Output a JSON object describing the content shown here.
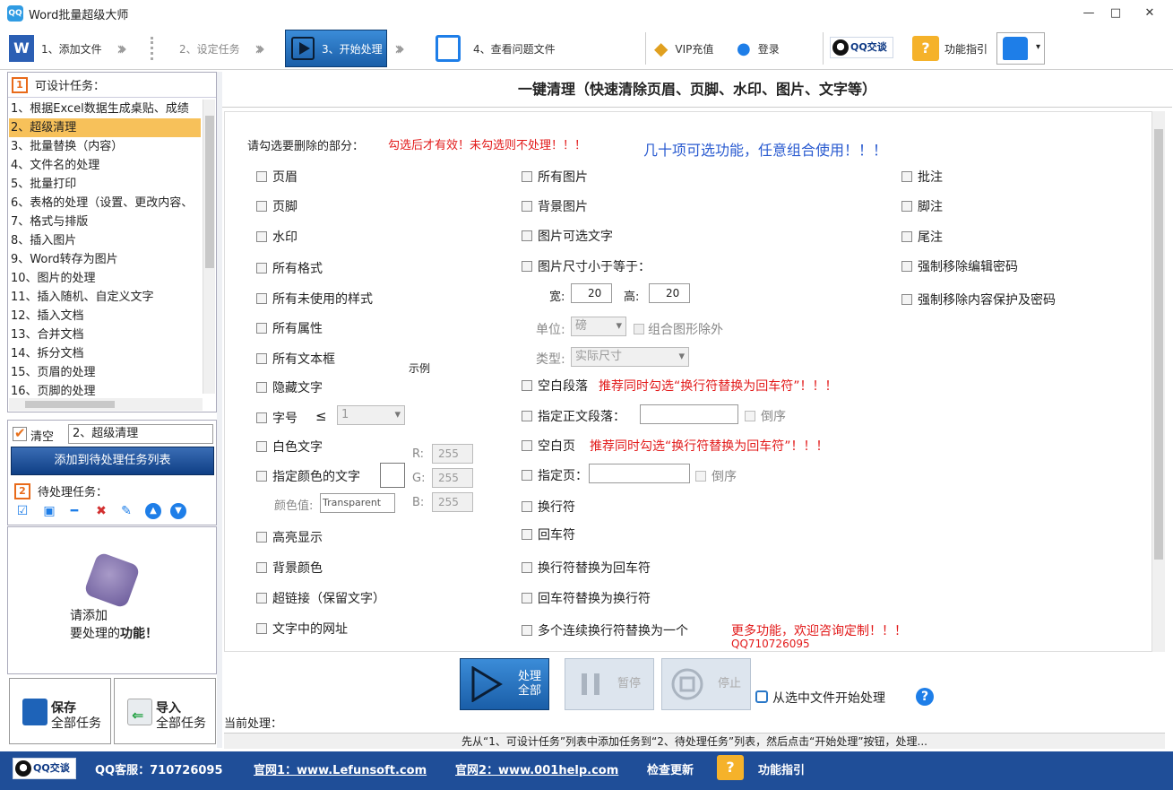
{
  "window": {
    "title": "Word批量超级大师",
    "app_icon": "QQ"
  },
  "toolbar": {
    "step1": "1、添加文件",
    "step2": "2、设定任务",
    "step3": "3、开始处理",
    "step4": "4、查看问题文件",
    "vip": "VIP充值",
    "login": "登录",
    "qq_read": "QQ交谈",
    "guide": "功能指引"
  },
  "left": {
    "designable_title": "可设计任务：",
    "tasks": [
      "1、根据Excel数据生成桌贴、成绩",
      "2、超级清理",
      "3、批量替换（内容）",
      "4、文件名的处理",
      "5、批量打印",
      "6、表格的处理（设置、更改内容、",
      "7、格式与排版",
      "8、插入图片",
      "9、Word转存为图片",
      "10、图片的处理",
      "11、插入随机、自定义文字",
      "12、插入文档",
      "13、合并文档",
      "14、拆分文档",
      "15、页眉的处理",
      "16、页脚的处理"
    ],
    "selected_index": 1,
    "clear_label": "清空",
    "clear_value": "2、超级清理",
    "add_button": "添加到待处理任务列表",
    "pending_title": "待处理任务：",
    "pending_hint1": "请添加",
    "pending_hint2a": "要处理的",
    "pending_hint2b": "功能！",
    "save_t1": "保存",
    "save_t2": "全部任务",
    "import_t1": "导入",
    "import_t2": "全部任务",
    "icons": [
      "check-all-icon",
      "uncheck-icon",
      "minus-icon",
      "delete-icon",
      "clear-icon",
      "move-up-icon",
      "move-down-icon"
    ]
  },
  "main": {
    "heading": "一键清理（快速清除页眉、页脚、水印、图片、文字等）",
    "prompt": "请勾选要删除的部分：",
    "warn": "勾选后才有效！未勾选则不处理！！！",
    "tip": "几十项可选功能，任意组合使用！！！",
    "col1": [
      "页眉",
      "页脚",
      "水印",
      "所有格式",
      "所有未使用的样式",
      "所有属性",
      "所有文本框",
      "隐藏文字",
      "字号",
      "白色文字",
      "指定颜色的文字",
      "高亮显示",
      "背景颜色",
      "超链接（保留文字）",
      "文字中的网址"
    ],
    "example": "示例",
    "font_size_op": "≤",
    "font_size_val": "1",
    "rgb_r_label": "R:",
    "rgb_g_label": "G:",
    "rgb_b_label": "B:",
    "rgb_r": "255",
    "rgb_g": "255",
    "rgb_b": "255",
    "color_value_label": "颜色值:",
    "color_value": "Transparent",
    "col2": [
      "所有图片",
      "背景图片",
      "图片可选文字",
      "图片尺寸小于等于："
    ],
    "width_label": "宽:",
    "width_val": "20",
    "height_label": "高:",
    "height_val": "20",
    "unit_label": "单位:",
    "unit_val": "磅",
    "exclude_group": "组合图形除外",
    "type_label": "类型:",
    "type_val": "实际尺寸",
    "blank_para": "空白段落",
    "blank_para_warn": "推荐同时勾选“换行符替换为回车符”！！！",
    "spec_para": "指定正文段落：",
    "reverse1": "倒序",
    "blank_page": "空白页",
    "blank_page_warn": "推荐同时勾选“换行符替换为回车符”！！！",
    "spec_page": "指定页：",
    "reverse2": "倒序",
    "col2b": [
      "换行符",
      "回车符",
      "换行符替换为回车符",
      "回车符替换为换行符",
      "多个连续换行符替换为一个"
    ],
    "more_func": "更多功能，欢迎咨询定制！！！",
    "qq_contact": "QQ710726095",
    "col3": [
      "批注",
      "脚注",
      "尾注",
      "强制移除编辑密码",
      "强制移除内容保护及密码"
    ]
  },
  "controls": {
    "process_t1": "处理",
    "process_t2": "全部",
    "pause": "暂停",
    "stop": "停止",
    "from_selected": "从选中文件开始处理",
    "help": "?",
    "current": "当前处理：",
    "status": "先从“1、可设计任务”列表中添加任务到“2、待处理任务”列表，然后点击“开始处理”按钮，处理..."
  },
  "footer": {
    "qq": "QQ交谈",
    "service": "QQ客服：710726095",
    "site1": "官网1：www.Lefunsoft.com",
    "site2": "官网2：www.001help.com",
    "update": "检查更新",
    "guide": "功能指引"
  },
  "colors": {
    "accent": "#1a5ea8",
    "footer": "#1f4e98",
    "warn": "#e21a1a",
    "tip": "#2a5bd0",
    "selected": "#f7c15a"
  }
}
